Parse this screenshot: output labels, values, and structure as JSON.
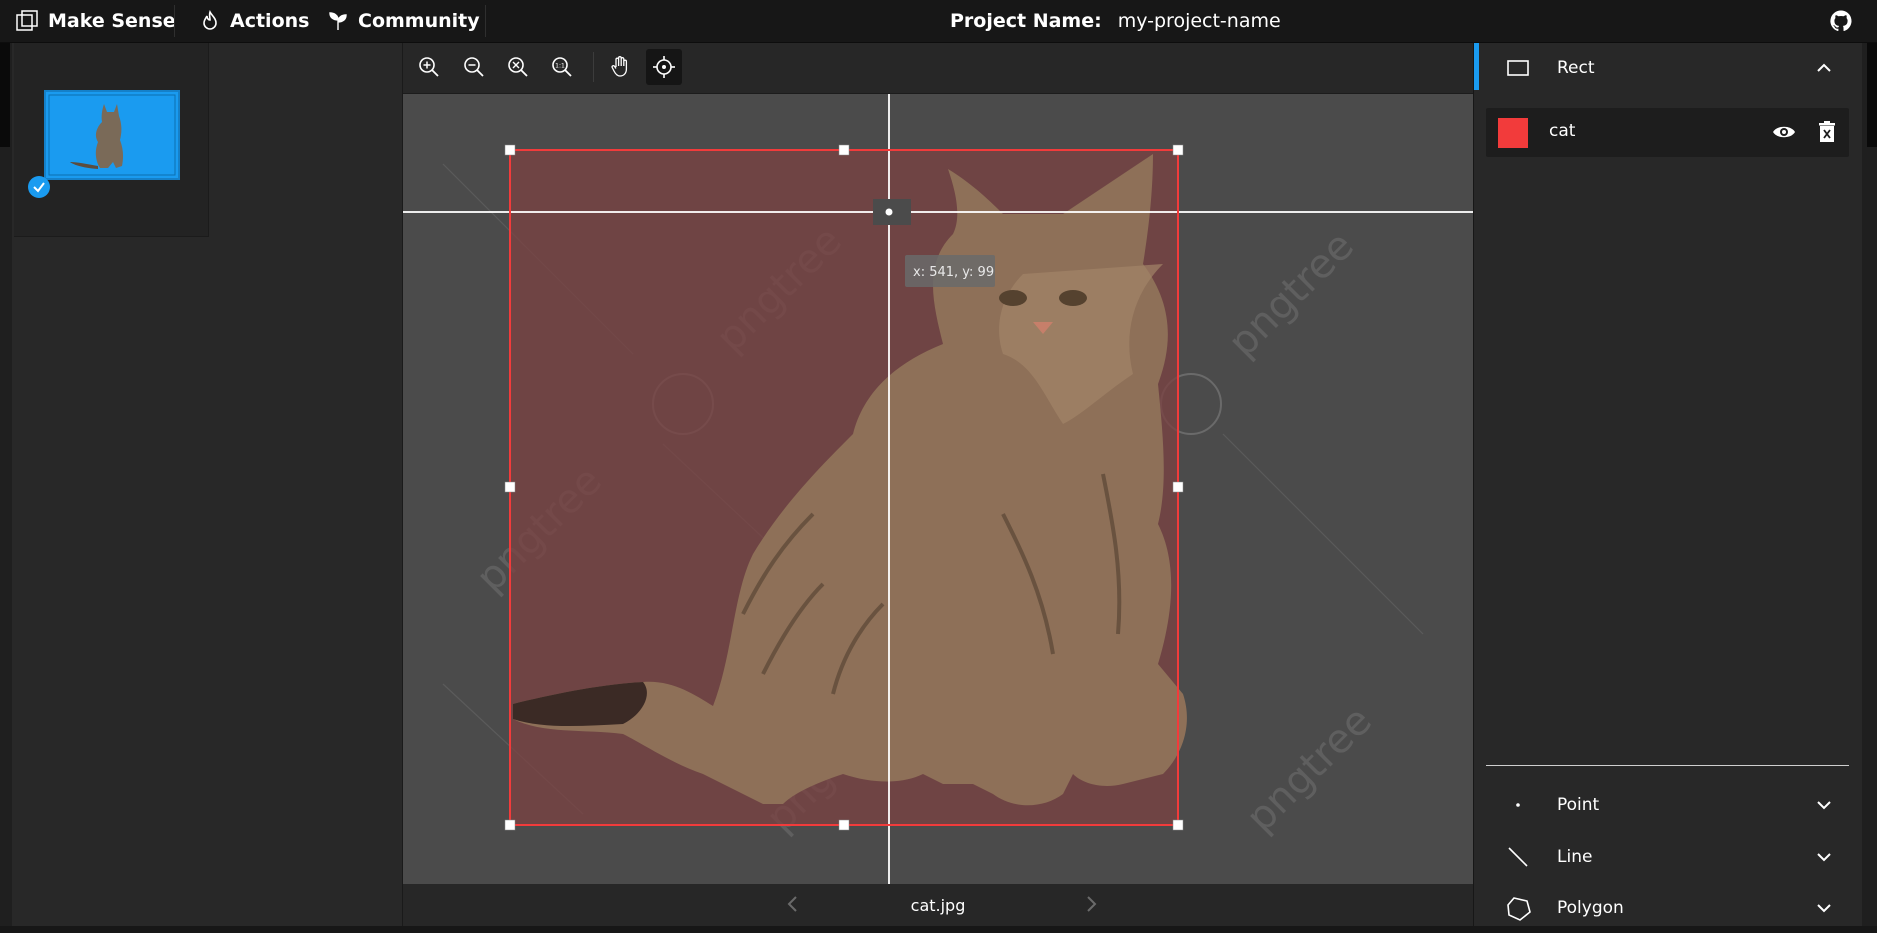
{
  "topbar": {
    "brand": "Make Sense",
    "actions": "Actions",
    "community": "Community",
    "project_label": "Project Name:",
    "project_value": "my-project-name"
  },
  "images": [
    {
      "name": "cat.jpg",
      "selected": true,
      "labeled": true
    }
  ],
  "toolbar": {
    "tools": [
      "zoom-in-icon",
      "zoom-out-icon",
      "zoom-fit-icon",
      "zoom-actual-size-icon",
      "pan-hand-icon",
      "crosshair-icon"
    ],
    "active_tool": "crosshair-icon"
  },
  "canvas": {
    "cursor_readout": "x: 541, y: 99",
    "annotation": {
      "label": "cat",
      "color": "#f23b3b"
    },
    "watermark": "pngtree"
  },
  "footer": {
    "filename": "cat.jpg"
  },
  "right_panel": {
    "label_types": {
      "rect": "Rect",
      "point": "Point",
      "line": "Line",
      "polygon": "Polygon"
    },
    "active_type": "Rect",
    "labels": [
      {
        "name": "cat",
        "color": "#f23b3b",
        "visible": true
      }
    ]
  },
  "colors": {
    "accent": "#1a9bf0",
    "label_red": "#f23b3b",
    "panel_bg": "#282828",
    "topbar_bg": "#171717"
  }
}
